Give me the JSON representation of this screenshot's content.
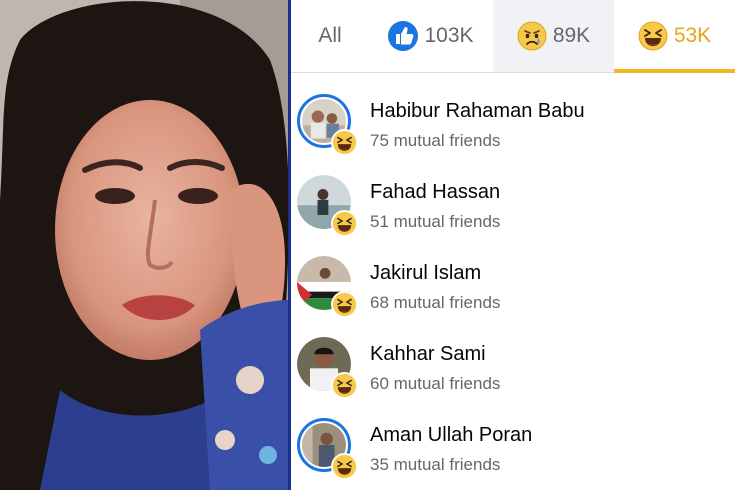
{
  "tabs": [
    {
      "id": "all",
      "label": "All",
      "icon": "",
      "count": ""
    },
    {
      "id": "like",
      "label": "",
      "icon": "like-reaction-icon",
      "count": "103K"
    },
    {
      "id": "sad",
      "label": "",
      "icon": "sad-reaction-icon",
      "count": "89K"
    },
    {
      "id": "haha",
      "label": "",
      "icon": "haha-reaction-icon",
      "count": "53K",
      "active": true
    }
  ],
  "people": [
    {
      "name": "Habibur Rahaman Babu",
      "mutual": "75 mutual friends",
      "reaction": "haha-reaction-icon",
      "story_ring": true
    },
    {
      "name": "Fahad Hassan",
      "mutual": "51 mutual friends",
      "reaction": "haha-reaction-icon",
      "story_ring": false
    },
    {
      "name": "Jakirul Islam",
      "mutual": "68 mutual friends",
      "reaction": "haha-reaction-icon",
      "story_ring": false
    },
    {
      "name": "Kahhar Sami",
      "mutual": "60 mutual friends",
      "reaction": "haha-reaction-icon",
      "story_ring": false
    },
    {
      "name": "Aman Ullah Poran",
      "mutual": "35 mutual friends",
      "reaction": "haha-reaction-icon",
      "story_ring": true
    }
  ],
  "colors": {
    "accent_blue": "#1b74e4",
    "haha_yellow": "#f5b623",
    "divider_navy": "#1b2f8c",
    "muted_text": "#65676b"
  }
}
